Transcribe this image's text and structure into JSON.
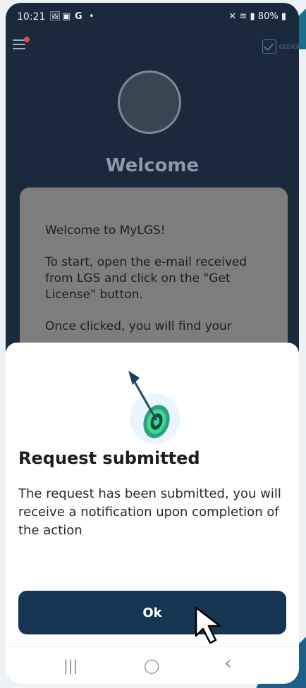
{
  "status_bar": {
    "time": "10:21",
    "left_icons": [
      "image-icon",
      "teams-icon",
      "google-icon",
      "dot-icon"
    ],
    "right_text": "80%",
    "right_icons": [
      "mute-icon",
      "wifi-icon",
      "signal-icon",
      "battery-icon"
    ]
  },
  "app_bar": {
    "menu_icon": "menu-icon",
    "notification_badge_color": "#e24b4b",
    "brand_text": "GOSIGN"
  },
  "header": {
    "title": "Welcome"
  },
  "welcome_card": {
    "paragraphs": [
      "Welcome to MyLGS!",
      "To start, open the e-mail received from LGS and click on the \"Get License\" button.",
      "Once clicked, you will find your"
    ]
  },
  "dialog": {
    "icon": "target-arrow-icon",
    "title": "Request submitted",
    "message": "The request has been submitted, you will receive a notification upon completion of the action",
    "ok_label": "Ok"
  },
  "nav_bar": {
    "recents_glyph": "|||",
    "home_glyph": "◯",
    "back_glyph": "‹"
  },
  "colors": {
    "app_background": "#1a2a3c",
    "primary_button": "#163552",
    "accent_target": "#3ddc84"
  }
}
